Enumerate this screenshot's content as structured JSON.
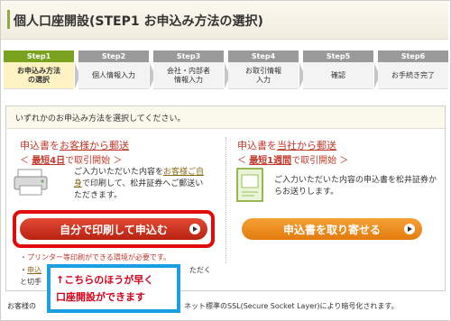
{
  "title": "個人口座開設(STEP1 お申込み方法の選択)",
  "steps": [
    {
      "num": "Step1",
      "label": "お申込み方法\nの選択",
      "active": true
    },
    {
      "num": "Step2",
      "label": "個人情報入力",
      "active": false
    },
    {
      "num": "Step3",
      "label": "会社・内部者\n情報入力",
      "active": false
    },
    {
      "num": "Step4",
      "label": "お取引情報\n入力",
      "active": false
    },
    {
      "num": "Step5",
      "label": "確認",
      "active": false
    },
    {
      "num": "Step6",
      "label": "お手続き完了",
      "active": false
    }
  ],
  "panel": {
    "instruction": "いずれかのお申込み方法を選択してください。",
    "left": {
      "title_a": "申込書を",
      "title_b": "お客様から郵送",
      "sub_pre": "＜ ",
      "sub_bold": "最短4日",
      "sub_post": "で取引開始 ＞",
      "desc_a": "ご入力いただいた内容を",
      "desc_link": "お客様ご自身",
      "desc_b": "で印刷して、松井証券へご郵送いただきます。",
      "button": "自分で印刷して申込む",
      "note1": "・プリンター等印刷ができる環境が必要です。",
      "note2_a": "・",
      "note2_link": "申込",
      "note2_b": "ただく",
      "note3": "と切手"
    },
    "right": {
      "title_a": "申込書を",
      "title_b": "当社から郵送",
      "sub_pre": "＜ ",
      "sub_bold": "最短1週間",
      "sub_post": "で取引開始 ＞",
      "desc": "ご入力いただいた内容の申込書を松井証券からお送りします。",
      "button": "申込書を取り寄せる"
    }
  },
  "callout": {
    "line1": "↑こちらのほうが早く",
    "line2": "口座開設ができます"
  },
  "footer": {
    "left": "お客様の",
    "right": "ネット標準のSSL(Secure Socket Layer)により暗号化されます。"
  },
  "colors": {
    "step_active": "#7aa21e",
    "step_inactive": "#9a9a9a",
    "accent_red": "#c0392b",
    "highlight_red": "#e00b0b",
    "callout_blue": "#1aa0e2",
    "button_red": "#cf3421",
    "button_orange": "#ef8f20"
  }
}
